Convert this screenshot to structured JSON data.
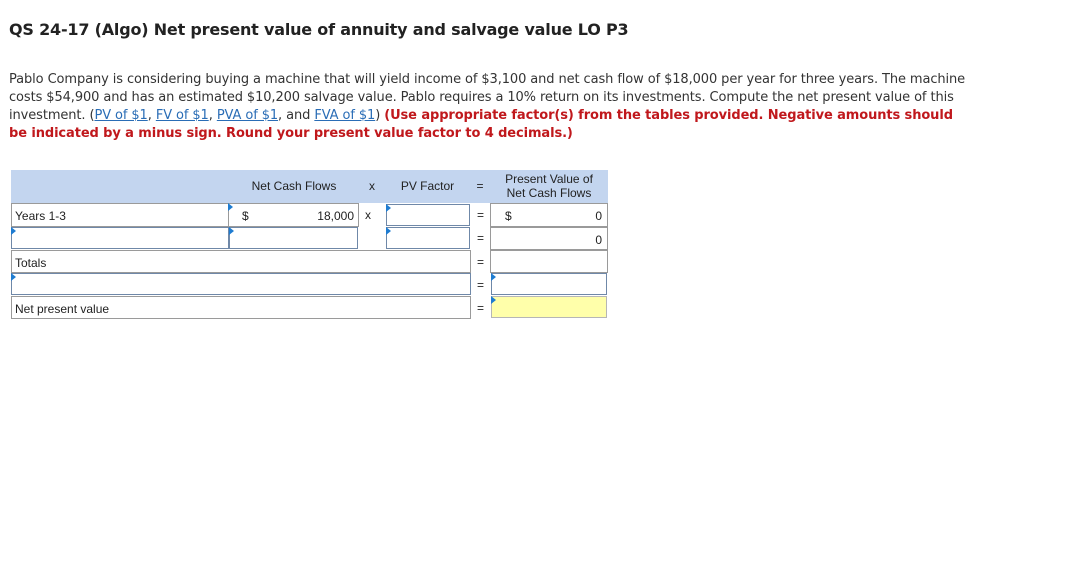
{
  "question": {
    "title": "QS 24-17 (Algo) Net present value of annuity and salvage value LO P3",
    "text_1": "Pablo Company is considering buying a machine that will yield income of $3,100 and net cash flow of $18,000 per year for three years. The machine costs $54,900 and has an estimated $10,200 salvage value. Pablo requires a 10% return on its investments. Compute the net present value of this investment. (",
    "link_pv": "PV of $1",
    "link_fv": "FV of $1",
    "link_pva": "PVA of $1",
    "link_and": "and",
    "link_fva": "FVA of $1",
    "text_2": ") ",
    "instructions": "(Use appropriate factor(s) from the tables provided. Negative amounts should be indicated by a minus sign. Round your present value factor to 4 decimals.)",
    "sep": ", "
  },
  "table": {
    "headers": {
      "net_cash_flows": "Net Cash Flows",
      "times": "x",
      "pv_factor": "PV Factor",
      "equals": "=",
      "present_value_line1": "Present Value of",
      "present_value_line2": "Net Cash Flows"
    },
    "rows": {
      "years_label": "Years 1-3",
      "dollar": "$",
      "net_cash_flow_value": "18,000",
      "times": "x",
      "equals": "=",
      "pv_dollar": "$",
      "pv_value_1": "0",
      "pv_value_2": "0",
      "totals_label": "Totals",
      "npv_label": "Net present value"
    }
  },
  "colors": {
    "header_bg": "#c3d5ef",
    "link": "#2a6db6",
    "instruction_red": "#c0181c",
    "input_flag": "#1e7cd1",
    "highlight_yellow": "#ffffaa"
  }
}
